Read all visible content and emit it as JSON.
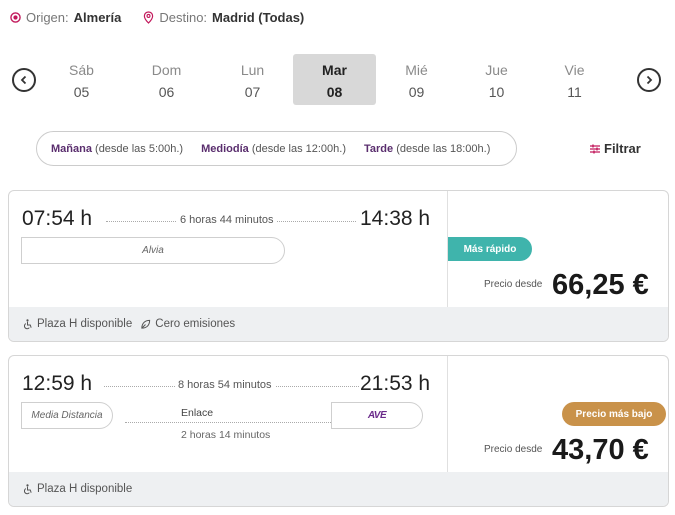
{
  "route": {
    "origin_label": "Origen:",
    "origin_value": "Almería",
    "destination_label": "Destino:",
    "destination_value": "Madrid (Todas)"
  },
  "dates": [
    {
      "dow": "Sáb",
      "num": "05",
      "selected": false
    },
    {
      "dow": "Dom",
      "num": "06",
      "selected": false
    },
    {
      "dow": "Lun",
      "num": "07",
      "selected": false
    },
    {
      "dow": "Mar",
      "num": "08",
      "selected": true
    },
    {
      "dow": "Mié",
      "num": "09",
      "selected": false
    },
    {
      "dow": "Jue",
      "num": "10",
      "selected": false
    },
    {
      "dow": "Vie",
      "num": "11",
      "selected": false
    }
  ],
  "timeslots": [
    {
      "name": "Mañana",
      "range": "(desde las 5:00h.)"
    },
    {
      "name": "Mediodía",
      "range": "(desde las 12:00h.)"
    },
    {
      "name": "Tarde",
      "range": "(desde las 18:00h.)"
    }
  ],
  "filter_label": "Filtrar",
  "results": [
    {
      "depart": "07:54 h",
      "arrive": "14:38 h",
      "duration": "6 horas 44 minutos",
      "train": "Alvia",
      "badge": "Más rápido",
      "badge_color": "#3fb4ac",
      "price_label": "Precio desde",
      "price": "66,25 €",
      "features": [
        "Plaza H disponible",
        "Cero emisiones"
      ]
    },
    {
      "depart": "12:59 h",
      "arrive": "21:53 h",
      "duration": "8 horas 54 minutos",
      "train": "Media Distancia",
      "train2": "AVE",
      "connection_label": "Enlace",
      "connection_time": "2 horas 14 minutos",
      "badge": "Precio más bajo",
      "badge_color": "#c9924a",
      "price_label": "Precio desde",
      "price": "43,70 €",
      "features": [
        "Plaza H disponible"
      ]
    }
  ],
  "colors": {
    "accent": "#5a2e6e",
    "pin": "#c2185b"
  }
}
